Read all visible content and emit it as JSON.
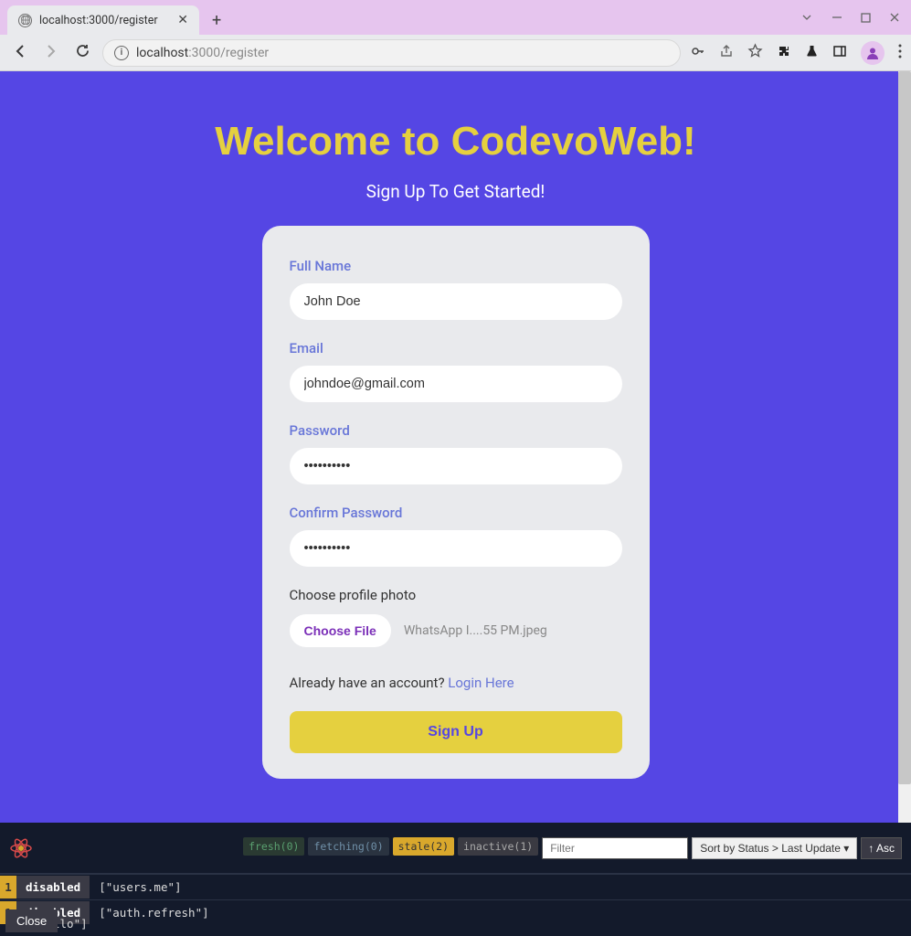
{
  "browser": {
    "tab_title": "localhost:3000/register",
    "url_host": "localhost",
    "url_port": ":3000",
    "url_path": "/register"
  },
  "page": {
    "title": "Welcome to CodevoWeb!",
    "subtitle": "Sign Up To Get Started!"
  },
  "form": {
    "fullname_label": "Full Name",
    "fullname_value": "John Doe",
    "email_label": "Email",
    "email_value": "johndoe@gmail.com",
    "password_label": "Password",
    "password_value": "••••••••••",
    "confirm_label": "Confirm Password",
    "confirm_value": "••••••••••",
    "photo_label": "Choose profile photo",
    "choose_file_label": "Choose File",
    "chosen_file_name": "WhatsApp I....55 PM.jpeg",
    "login_prompt": "Already have an account? ",
    "login_link": "Login Here",
    "submit_label": "Sign Up"
  },
  "devtools": {
    "fresh": "fresh(0)",
    "fetching": "fetching(0)",
    "stale": "stale(2)",
    "inactive": "inactive(1)",
    "filter_placeholder": "Filter",
    "sort_label": "Sort by Status > Last Update",
    "asc_label": "↑ Asc",
    "close_label": "Close",
    "queries": [
      {
        "count": "1",
        "status": "disabled",
        "key": "[\"users.me\"]"
      },
      {
        "count": "1",
        "status": "disabled",
        "key": "[\"auth.refresh\"]"
      }
    ],
    "partial_key": "llo\"]"
  }
}
